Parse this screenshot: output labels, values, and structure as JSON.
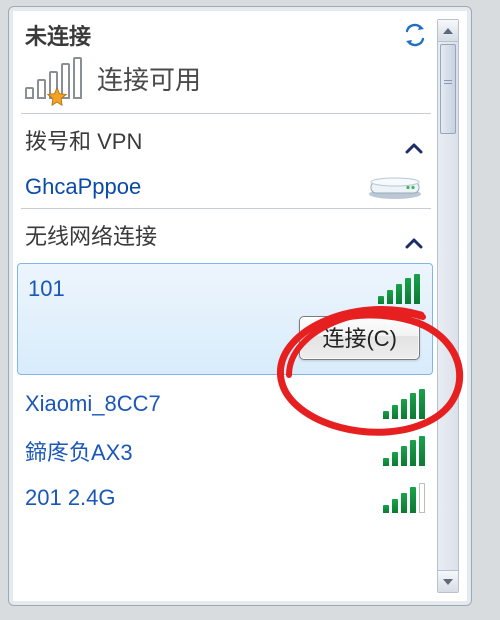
{
  "header": {
    "status": "未连接",
    "refresh_icon": "refresh-icon"
  },
  "availability": {
    "label": "连接可用",
    "icon": "signal-available-icon"
  },
  "dial_section": {
    "title": "拨号和 VPN",
    "items": [
      {
        "name": "GhcaPppoe",
        "icon": "dialup-modem-icon"
      }
    ]
  },
  "wifi_section": {
    "title": "无线网络连接",
    "networks": [
      {
        "ssid": "101",
        "strength": 5,
        "selected": true
      },
      {
        "ssid": "Xiaomi_8CC7",
        "strength": 5,
        "selected": false
      },
      {
        "ssid": "鍗庝负AX3",
        "strength": 5,
        "selected": false
      },
      {
        "ssid": "201 2.4G",
        "strength": 4,
        "selected": false
      }
    ],
    "connect_label": "连接(C)"
  },
  "annotation": {
    "color": "#e62020",
    "shape": "ellipse"
  }
}
